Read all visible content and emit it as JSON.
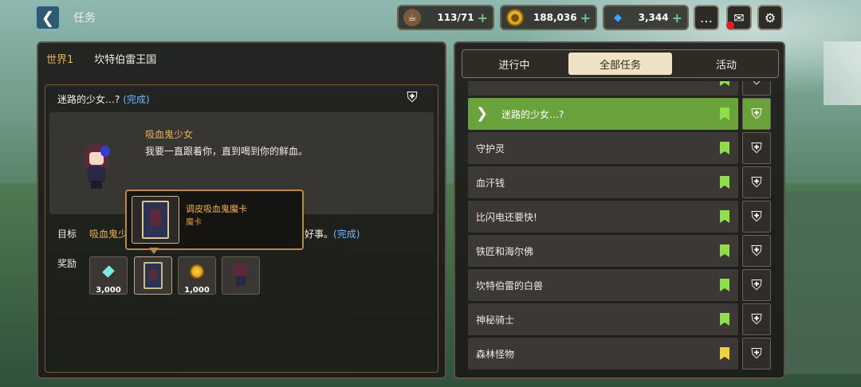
{
  "header": {
    "back_icon": "chevron-left-icon",
    "title": "任务",
    "resources": [
      {
        "icon": "coffee-icon",
        "value": "113/71"
      },
      {
        "icon": "coin-icon",
        "value": "188,036"
      },
      {
        "icon": "gem-icon",
        "value": "3,344"
      }
    ],
    "icons": [
      "chat-icon",
      "mail-icon",
      "gear-icon"
    ]
  },
  "left": {
    "world": "世界1",
    "kingdom": "坎特伯雷王国",
    "quest_title": "迷路的少女…?",
    "quest_status": "(完成)",
    "npc_name": "吸血鬼少女",
    "npc_line": "我要一直跟着你，直到喝到你的鲜血。",
    "target_label": "目标",
    "target_text": "吸血鬼少",
    "target_end": "好事。",
    "target_status": "(完成)",
    "reward_label": "奖励",
    "rewards": [
      {
        "icon": "gem-icon",
        "qty": "3,000"
      },
      {
        "icon": "card-icon",
        "qty": ""
      },
      {
        "icon": "coin-icon",
        "qty": "1,000"
      },
      {
        "icon": "character-icon",
        "qty": ""
      }
    ]
  },
  "tooltip": {
    "name": "调皮吸血鬼魔卡",
    "type": "魔卡"
  },
  "right": {
    "tabs": [
      "进行中",
      "全部任务",
      "活动"
    ],
    "active_tab": "全部任务",
    "quests": [
      {
        "name": "",
        "flag": "green",
        "selected": false
      },
      {
        "name": "迷路的少女…?",
        "flag": "green",
        "selected": true
      },
      {
        "name": "守护灵",
        "flag": "green",
        "selected": false
      },
      {
        "name": "血汗钱",
        "flag": "green",
        "selected": false
      },
      {
        "name": "比闪电还要快!",
        "flag": "green",
        "selected": false
      },
      {
        "name": "铁匠和海尔佛",
        "flag": "green",
        "selected": false
      },
      {
        "name": "坎特伯雷的白兽",
        "flag": "green",
        "selected": false
      },
      {
        "name": "神秘骑士",
        "flag": "green",
        "selected": false
      },
      {
        "name": "森林怪物",
        "flag": "yellow",
        "selected": false
      }
    ]
  },
  "colors": {
    "accent_green": "#6aa33c",
    "gold_text": "#e7b05a",
    "done_blue": "#6fb6ff"
  }
}
